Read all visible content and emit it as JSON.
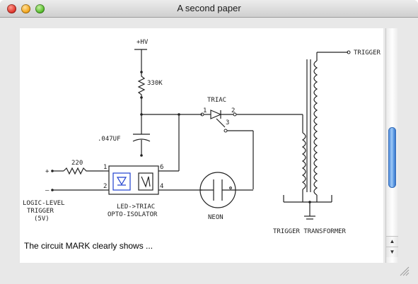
{
  "window": {
    "title": "A second paper"
  },
  "icons": {
    "close": "close-icon",
    "minimize": "minimize-icon",
    "zoom": "zoom-icon",
    "scroll_up": "chevron-up-icon",
    "scroll_down": "chevron-down-icon",
    "resize": "resize-grip-icon"
  },
  "diagram": {
    "labels": {
      "hv": "+HV",
      "r1": "330K",
      "cap": ".047UF",
      "triac": "TRIAC",
      "t1": "1",
      "t2": "2",
      "t3": "3",
      "r2": "220",
      "plus": "+",
      "minus": "–",
      "pin1": "1",
      "pin2": "2",
      "pin6": "6",
      "pin4": "4",
      "logic1": "LOGIC-LEVEL",
      "logic2": "TRIGGER",
      "logic3": "(5V)",
      "opto1": "LED->TRIAC",
      "opto2": "OPTO-ISOLATOR",
      "neon": "NEON",
      "trigger_out": "TRIGGER",
      "transformer": "TRIGGER TRANSFORMER"
    }
  },
  "caption": "The circuit MARK clearly shows ...",
  "colors": {
    "led": "#1f3fcf",
    "scroll_thumb": "#5b98e2"
  }
}
